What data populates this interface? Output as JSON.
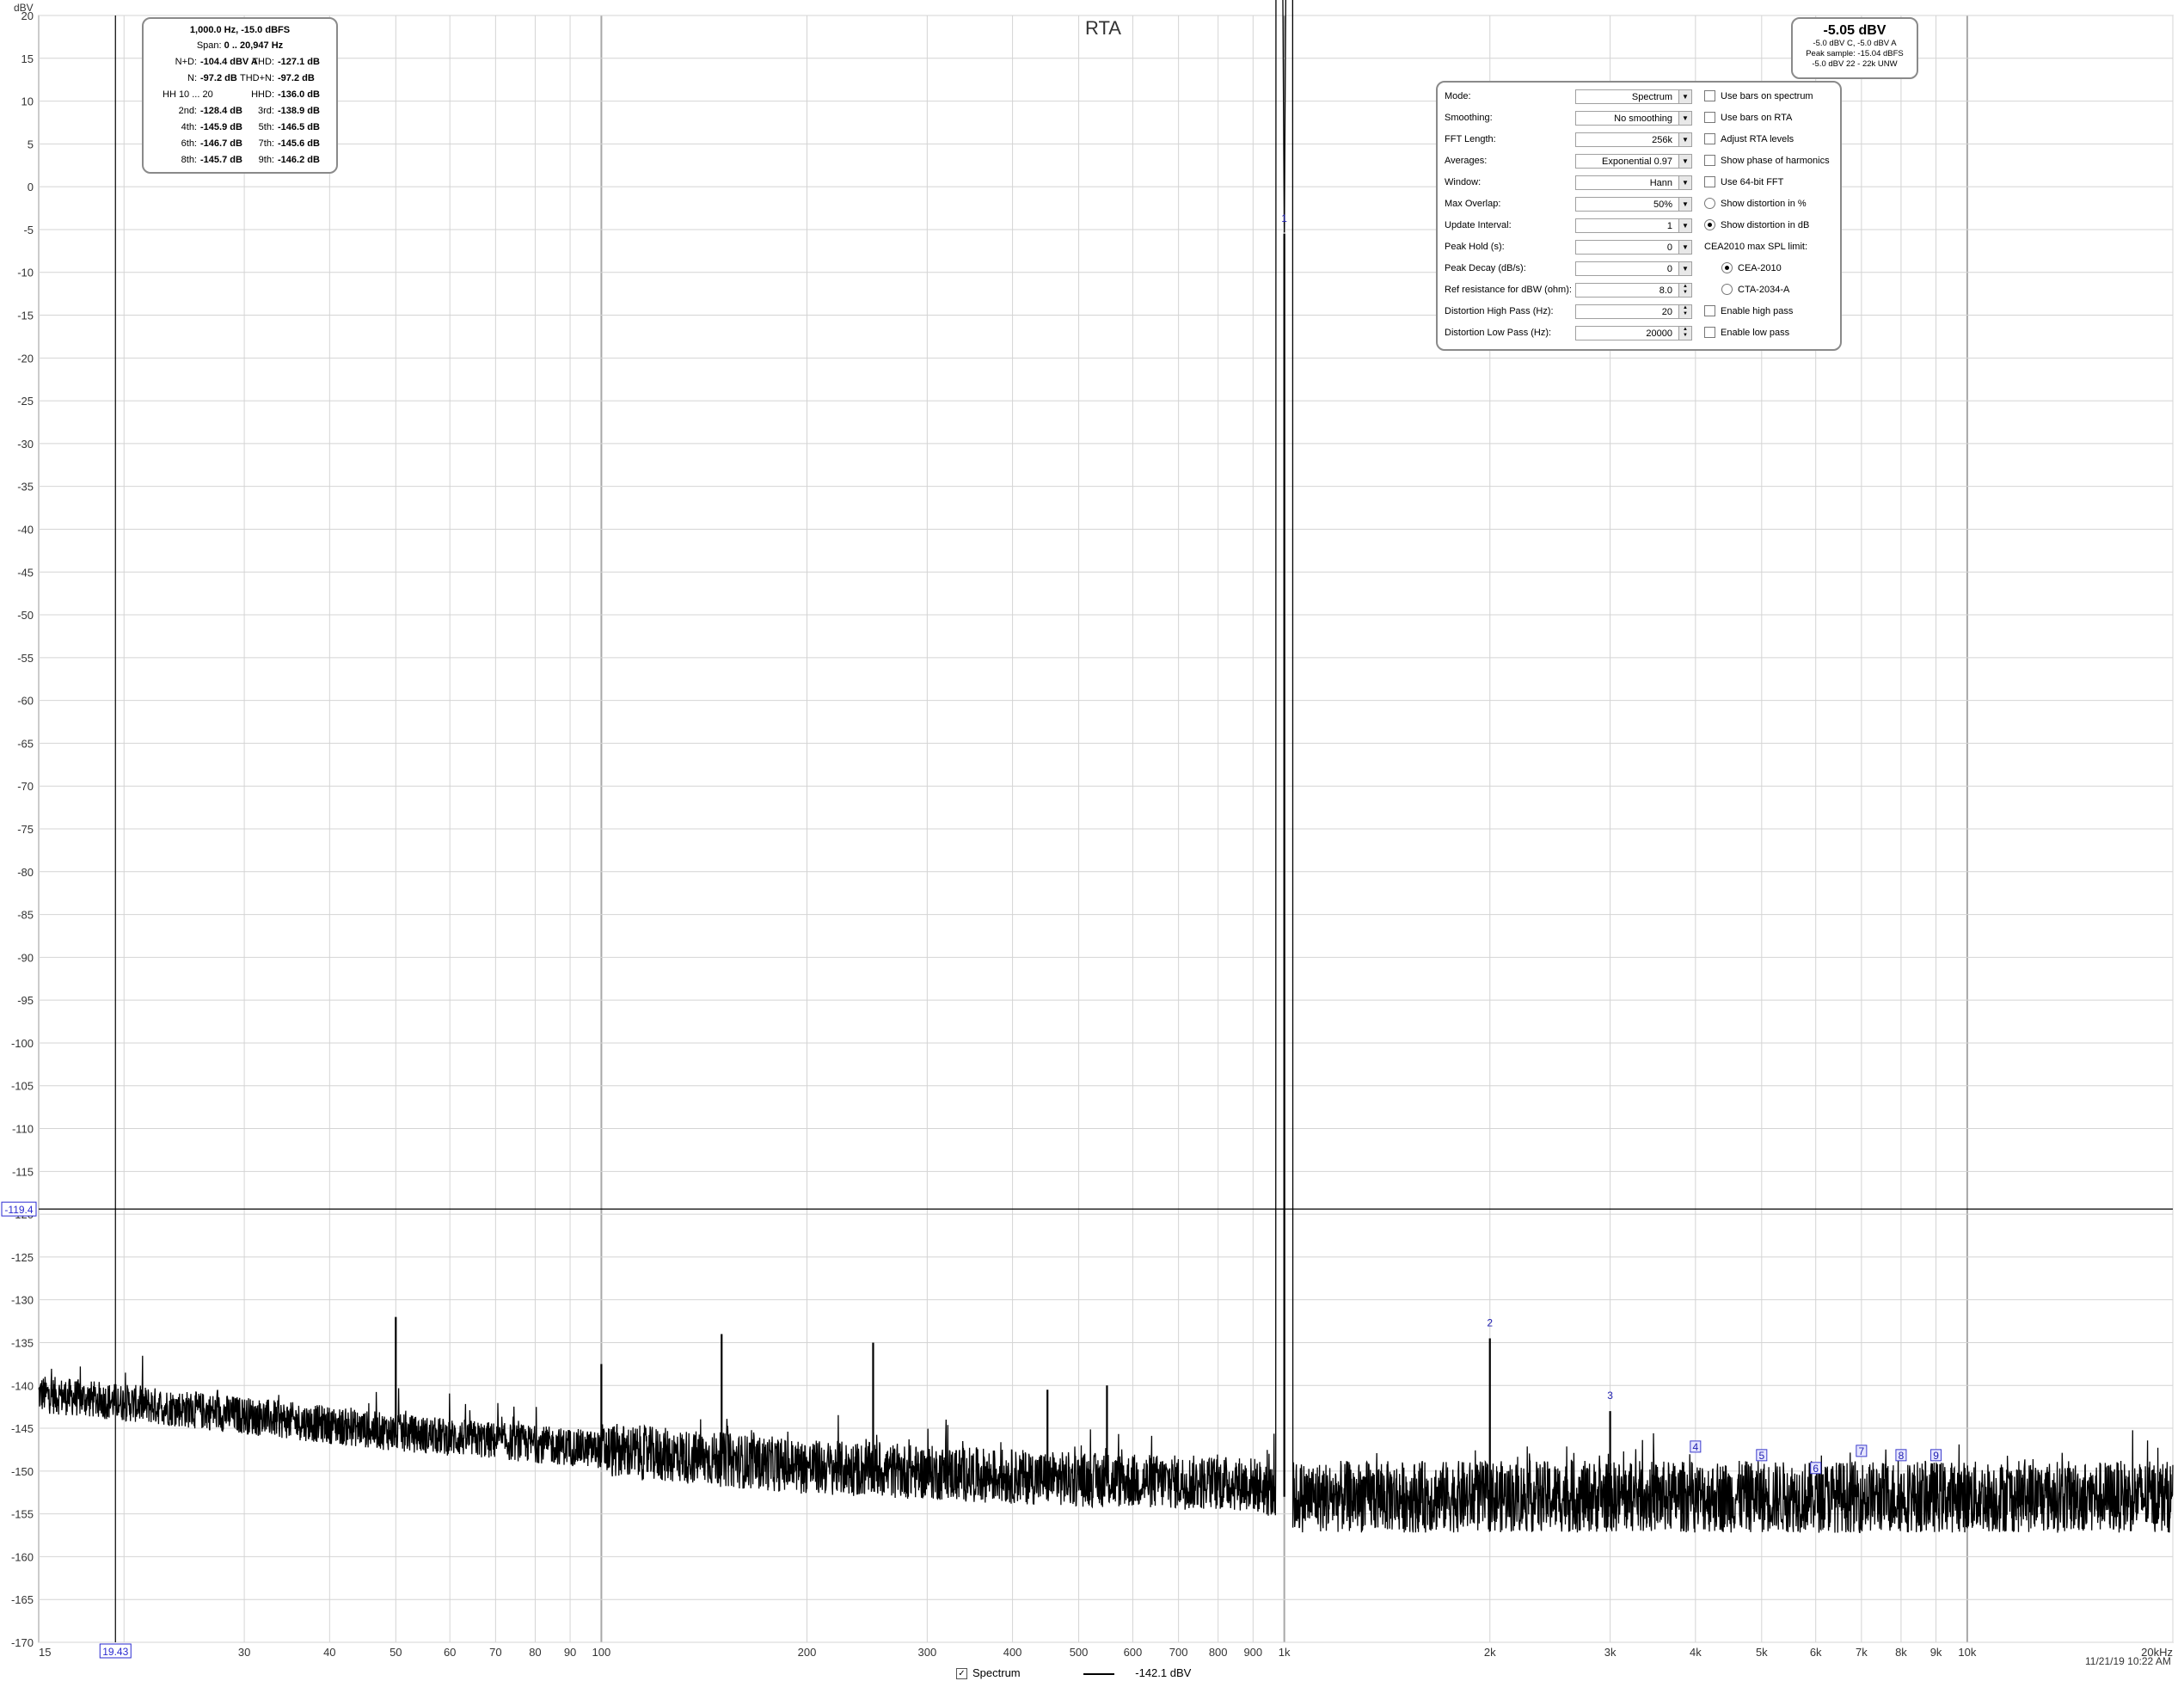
{
  "chart_data": {
    "type": "line",
    "title": "RTA",
    "ylabel": "dBV",
    "xscale": "log",
    "xlim": [
      15,
      20000
    ],
    "ylim": [
      -170,
      20
    ],
    "grid": true,
    "x_ticks": [
      15,
      30,
      40,
      50,
      60,
      70,
      80,
      90,
      100,
      200,
      300,
      400,
      500,
      600,
      700,
      800,
      900,
      1000,
      2000,
      3000,
      4000,
      5000,
      6000,
      7000,
      8000,
      9000,
      10000,
      20000
    ],
    "x_tick_labels": [
      "15",
      "30",
      "40",
      "50",
      "60",
      "70",
      "80",
      "90",
      "100",
      "200",
      "300",
      "400",
      "500",
      "600",
      "700",
      "800",
      "900",
      "1k",
      "2k",
      "3k",
      "4k",
      "5k",
      "6k",
      "7k",
      "8k",
      "9k",
      "10k",
      "20kHz"
    ],
    "y_ticks": [
      20,
      15,
      10,
      5,
      0,
      -5,
      -10,
      -15,
      -20,
      -25,
      -30,
      -35,
      -40,
      -45,
      -50,
      -55,
      -60,
      -65,
      -70,
      -75,
      -80,
      -85,
      -90,
      -95,
      -100,
      -105,
      -110,
      -115,
      -120,
      -125,
      -130,
      -135,
      -140,
      -145,
      -150,
      -155,
      -160,
      -165,
      -170
    ],
    "series": [
      {
        "name": "Spectrum",
        "color": "#000000",
        "noise_floor": [
          [
            15,
            -141
          ],
          [
            20,
            -142
          ],
          [
            30,
            -143.5
          ],
          [
            50,
            -145.5
          ],
          [
            100,
            -147.5
          ],
          [
            200,
            -149.5
          ],
          [
            500,
            -151
          ],
          [
            900,
            -151.5
          ],
          [
            1000,
            -153
          ],
          [
            2000,
            -153
          ],
          [
            5000,
            -153
          ],
          [
            10000,
            -153
          ],
          [
            20000,
            -153
          ]
        ],
        "spikes": [
          {
            "freq": 50,
            "level": -132
          },
          {
            "freq": 100,
            "level": -137.5
          },
          {
            "freq": 150,
            "level": -134
          },
          {
            "freq": 250,
            "level": -135
          },
          {
            "freq": 450,
            "level": -140.5
          },
          {
            "freq": 550,
            "level": -140
          },
          {
            "freq": 1000,
            "level": -5.5
          },
          {
            "freq": 2000,
            "level": -134.5
          },
          {
            "freq": 3000,
            "level": -143
          }
        ]
      }
    ],
    "harmonic_markers": [
      {
        "label": "1",
        "freq": 1000,
        "level": -5.5
      },
      {
        "label": "2",
        "freq": 2000,
        "level": -134.5
      },
      {
        "label": "3",
        "freq": 3000,
        "level": -143
      },
      {
        "label": "4",
        "freq": 4000,
        "level": -149
      },
      {
        "label": "5",
        "freq": 5000,
        "level": -150
      },
      {
        "label": "6",
        "freq": 6000,
        "level": -151.5
      },
      {
        "label": "7",
        "freq": 7000,
        "level": -149.5
      },
      {
        "label": "8",
        "freq": 8000,
        "level": -150
      },
      {
        "label": "9",
        "freq": 9000,
        "level": -150
      }
    ],
    "cursor": {
      "x": 19.43,
      "y": -119.4,
      "x_label": "19.43",
      "y_label": "-119.4"
    }
  },
  "distortion_panel": {
    "header": "1,000.0 Hz, -15.0 dBFS",
    "span_label": "Span:",
    "span_value": "0 .. 20,947 Hz",
    "rows": [
      {
        "l1": "N+D:",
        "v1": "-104.4 dBV A",
        "l2": "THD:",
        "v2": "-127.1 dB"
      },
      {
        "l1": "N:",
        "v1": "-97.2 dB",
        "l2": "THD+N:",
        "v2": "-97.2 dB"
      },
      {
        "l1": "HH 10 ... 20",
        "v1": "",
        "l2": "HHD:",
        "v2": "-136.0 dB"
      },
      {
        "l1": "2nd:",
        "v1": "-128.4 dB",
        "l2": "3rd:",
        "v2": "-138.9 dB"
      },
      {
        "l1": "4th:",
        "v1": "-145.9 dB",
        "l2": "5th:",
        "v2": "-146.5 dB"
      },
      {
        "l1": "6th:",
        "v1": "-146.7 dB",
        "l2": "7th:",
        "v2": "-145.6 dB"
      },
      {
        "l1": "8th:",
        "v1": "-145.7 dB",
        "l2": "9th:",
        "v2": "-146.2 dB"
      }
    ]
  },
  "level_panel": {
    "main": "-5.05 dBV",
    "line1": "-5.0 dBV C, -5.0 dBV A",
    "line2": "Peak sample: -15.04 dBFS",
    "line3": "-5.0 dBV 22 - 22k UNW"
  },
  "controls": {
    "rows": [
      {
        "label": "Mode:",
        "value": "Spectrum",
        "kind": "select",
        "check": "Use bars on spectrum",
        "check_kind": "box",
        "checked": false
      },
      {
        "label": "Smoothing:",
        "value": "No  smoothing",
        "kind": "select",
        "check": "Use bars on RTA",
        "check_kind": "box",
        "checked": false
      },
      {
        "label": "FFT Length:",
        "value": "256k",
        "kind": "select",
        "check": "Adjust RTA levels",
        "check_kind": "box",
        "checked": false
      },
      {
        "label": "Averages:",
        "value": "Exponential 0.97",
        "kind": "select",
        "check": "Show phase of harmonics",
        "check_kind": "box",
        "checked": false
      },
      {
        "label": "Window:",
        "value": "Hann",
        "kind": "select",
        "check": "Use 64-bit FFT",
        "check_kind": "box",
        "checked": false
      },
      {
        "label": "Max Overlap:",
        "value": "50%",
        "kind": "select",
        "check": "Show distortion in %",
        "check_kind": "radio",
        "checked": false
      },
      {
        "label": "Update Interval:",
        "value": "1",
        "kind": "select",
        "check": "Show distortion in dB",
        "check_kind": "radio",
        "checked": true
      },
      {
        "label": "Peak Hold (s):",
        "value": "0",
        "kind": "select",
        "check": "CEA2010 max SPL limit:",
        "check_kind": "none",
        "checked": false
      },
      {
        "label": "Peak Decay (dB/s):",
        "value": "0",
        "kind": "select",
        "check": "CEA-2010",
        "check_kind": "radio-indent",
        "checked": true
      },
      {
        "label": "Ref resistance for dBW (ohm):",
        "value": "8.0",
        "kind": "spin",
        "check": "CTA-2034-A",
        "check_kind": "radio-indent",
        "checked": false
      },
      {
        "label": "Distortion High Pass (Hz):",
        "value": "20",
        "kind": "spin",
        "check": "Enable high pass",
        "check_kind": "box",
        "checked": false
      },
      {
        "label": "Distortion Low Pass (Hz):",
        "value": "20000",
        "kind": "spin",
        "check": "Enable low pass",
        "check_kind": "box",
        "checked": false
      }
    ]
  },
  "legend": {
    "checkbox_label": "Spectrum",
    "value": "-142.1 dBV",
    "checked_glyph": "✓"
  },
  "timestamp": "11/21/19 10:22 AM"
}
